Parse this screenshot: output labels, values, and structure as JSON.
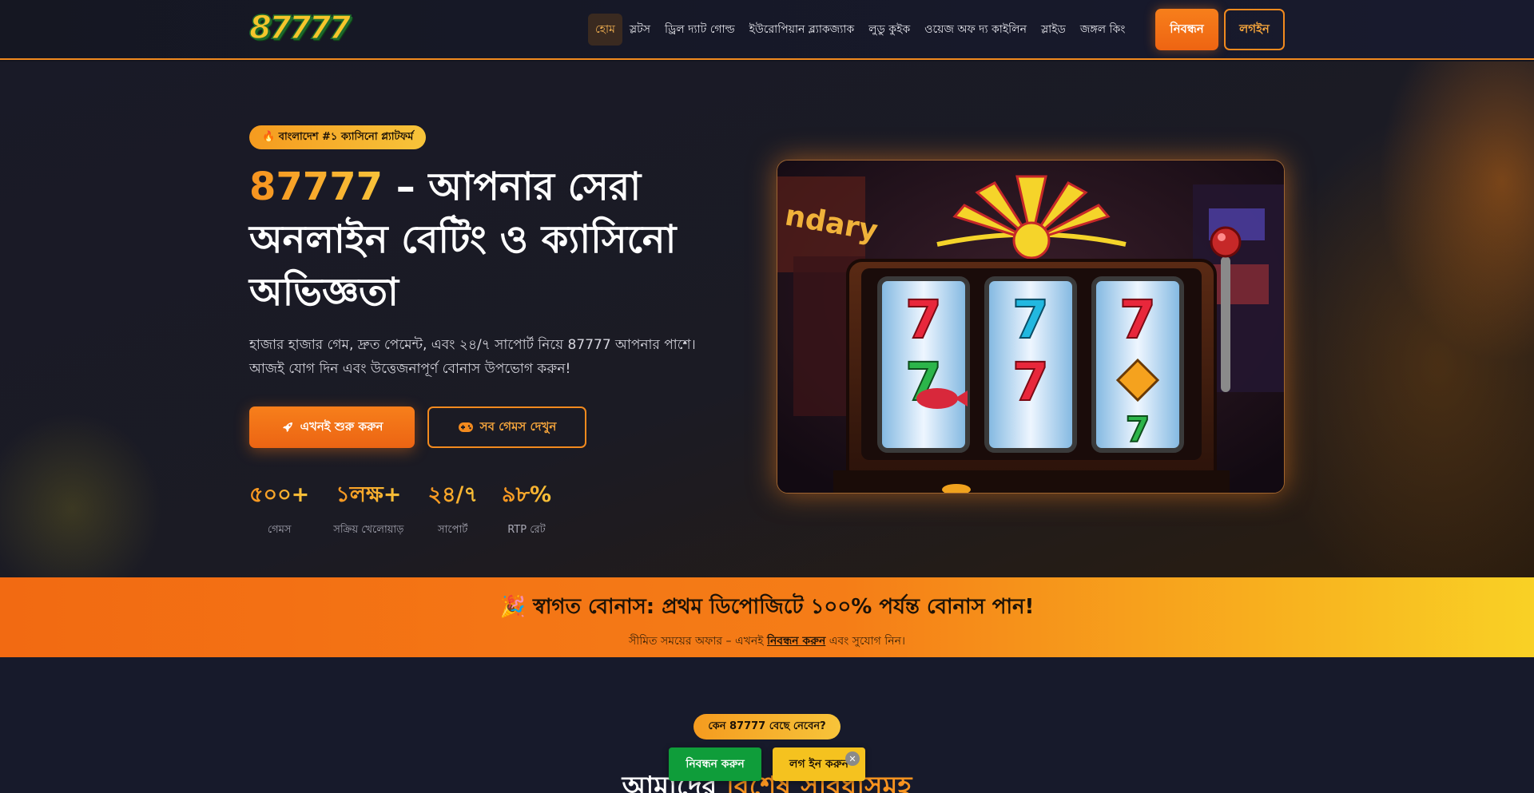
{
  "header": {
    "logo": "87777",
    "nav": [
      "হোম",
      "স্লটস",
      "ড্রিল দ্যাট গোল্ড",
      "ইউরোপিয়ান ব্ল্যাকজ্যাক",
      "লুডু কুইক",
      "ওয়েজ অফ দ্য কাইলিন",
      "স্লাইড",
      "জঙ্গল কিং"
    ],
    "active_nav": 0,
    "register_label": "নিবন্ধন",
    "login_label": "লগইন"
  },
  "hero": {
    "badge": "🔥 বাংলাদেশ #১ ক্যাসিনো প্ল্যাটফর্ম",
    "title_brand": "87777",
    "title_rest": " – আপনার সেরা অনলাইন বেটিং ও ক্যাসিনো অভিজ্ঞতা",
    "description": "হাজার হাজার গেম, দ্রুত পেমেন্ট, এবং ২৪/৭ সাপোর্ট নিয়ে 87777 আপনার পাশে। আজই যোগ দিন এবং উত্তেজনাপূর্ণ বোনাস উপভোগ করুন!",
    "start_button": "এখনই শুরু করুন",
    "games_button": "সব গেমস দেখুন",
    "stats": [
      {
        "value": "৫০০+",
        "label": "গেমস"
      },
      {
        "value": "১লক্ষ+",
        "label": "সক্রিয় খেলোয়াড়"
      },
      {
        "value": "২৪/৭",
        "label": "সাপোর্ট"
      },
      {
        "value": "৯৮%",
        "label": "RTP রেট"
      }
    ],
    "image_reels": [
      [
        "7",
        "7",
        "7"
      ],
      [
        "7",
        "7",
        "◆"
      ],
      [
        "🐟",
        "",
        "7"
      ]
    ]
  },
  "bonus": {
    "title": "🎉 স্বাগত বোনাস: প্রথম ডিপোজিটে ১০০% পর্যন্ত বোনাস পান!",
    "sub_before": "সীমিত সময়ের অফার – এখনই ",
    "sub_link": "নিবন্ধন করুন",
    "sub_after": " এবং সুযোগ নিন।"
  },
  "why": {
    "badge": "কেন 87777 বেছে নেবেন?",
    "title_start": "আমাদের ",
    "title_accent": "বিশেষ সুবিধাসমূহ"
  },
  "floating": {
    "register_label": "নিবন্ধন করুন",
    "login_label": "লগ ইন করুন",
    "close": "✕"
  },
  "colors": {
    "accent_orange": "#f77f1b",
    "accent_yellow": "#f8c33a",
    "register_green": "#0f9d3a",
    "background": "#14151f"
  }
}
